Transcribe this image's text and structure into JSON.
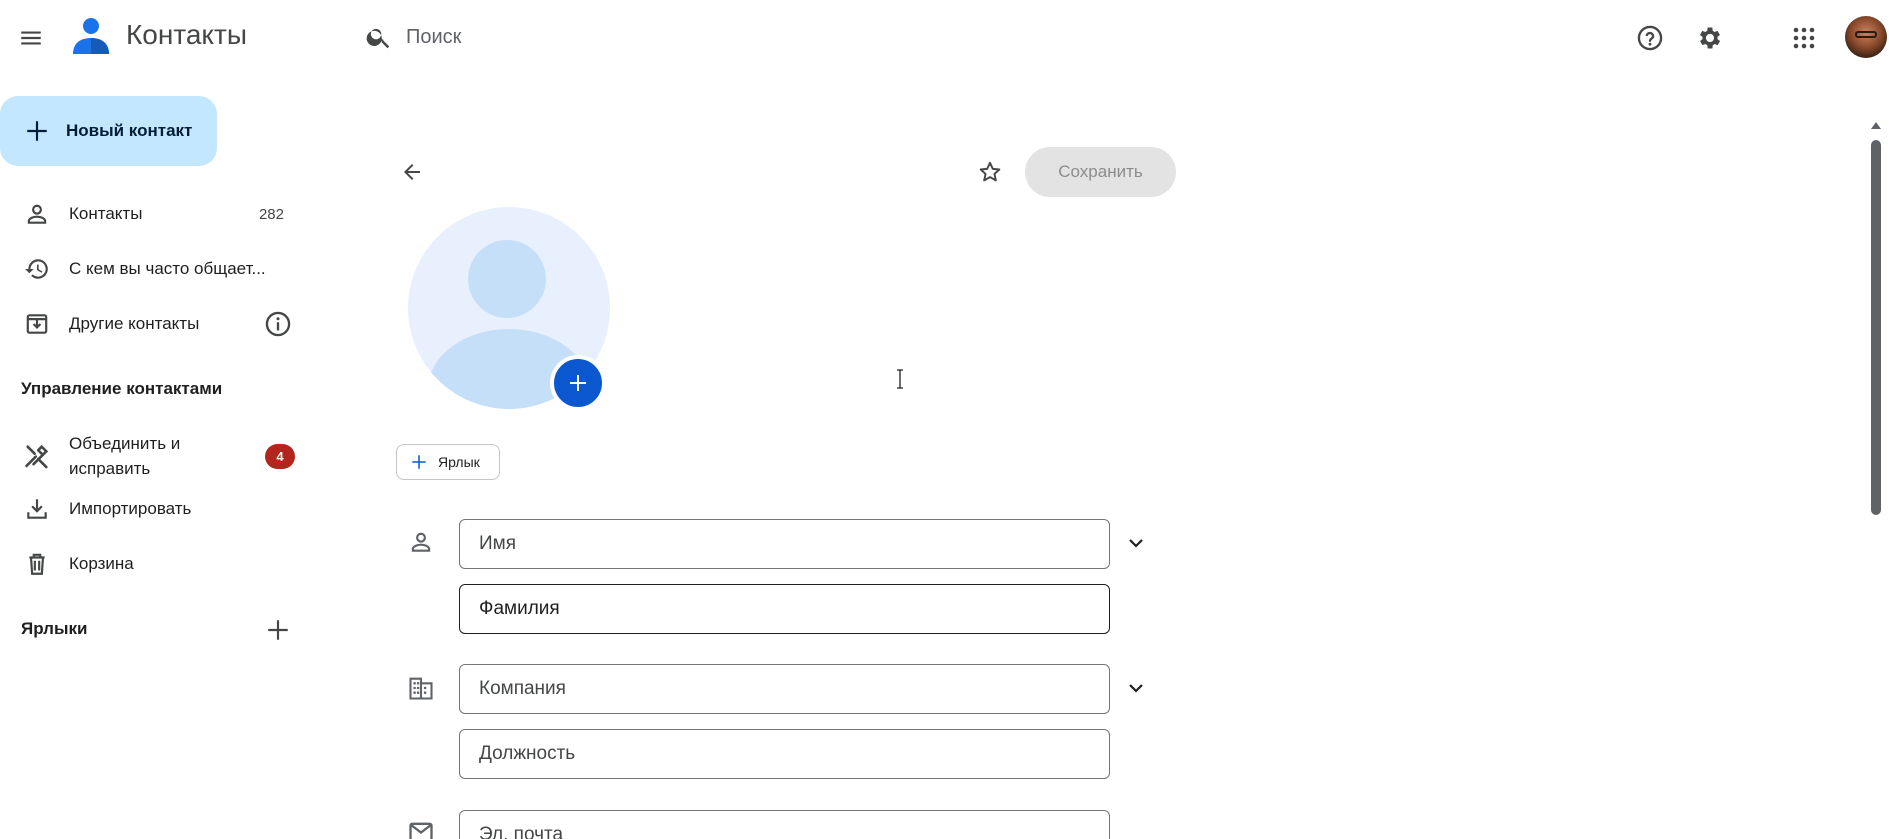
{
  "app": {
    "title": "Контакты"
  },
  "search": {
    "placeholder": "Поиск"
  },
  "sidebar": {
    "new_contact_label": "Новый контакт",
    "items": [
      {
        "label": "Контакты",
        "count": "282",
        "icon": "person-icon"
      },
      {
        "label": "С кем вы часто общает...",
        "icon": "history-icon"
      },
      {
        "label": "Другие контакты",
        "icon": "archive-download-icon",
        "info_icon": "info-icon"
      }
    ],
    "manage_heading": "Управление контактами",
    "manage_items": [
      {
        "label_line1": "Объединить и",
        "label_line2": "исправить",
        "badge": "4",
        "icon": "merge-fix-icon"
      },
      {
        "label": "Импортировать",
        "icon": "import-icon"
      },
      {
        "label": "Корзина",
        "icon": "trash-icon"
      }
    ],
    "labels_heading": "Ярлыки"
  },
  "editor": {
    "save_label": "Сохранить",
    "label_chip": "Ярлык",
    "fields": {
      "first_name_placeholder": "Имя",
      "last_name_placeholder": "Фамилия",
      "company_placeholder": "Компания",
      "job_title_placeholder": "Должность",
      "email_placeholder": "Эл. почта"
    }
  },
  "colors": {
    "accent": "#0b57d0",
    "new_contact_bg": "#c2e7ff",
    "badge": "#b3261e",
    "save_disabled_bg": "#e3e3e3"
  }
}
